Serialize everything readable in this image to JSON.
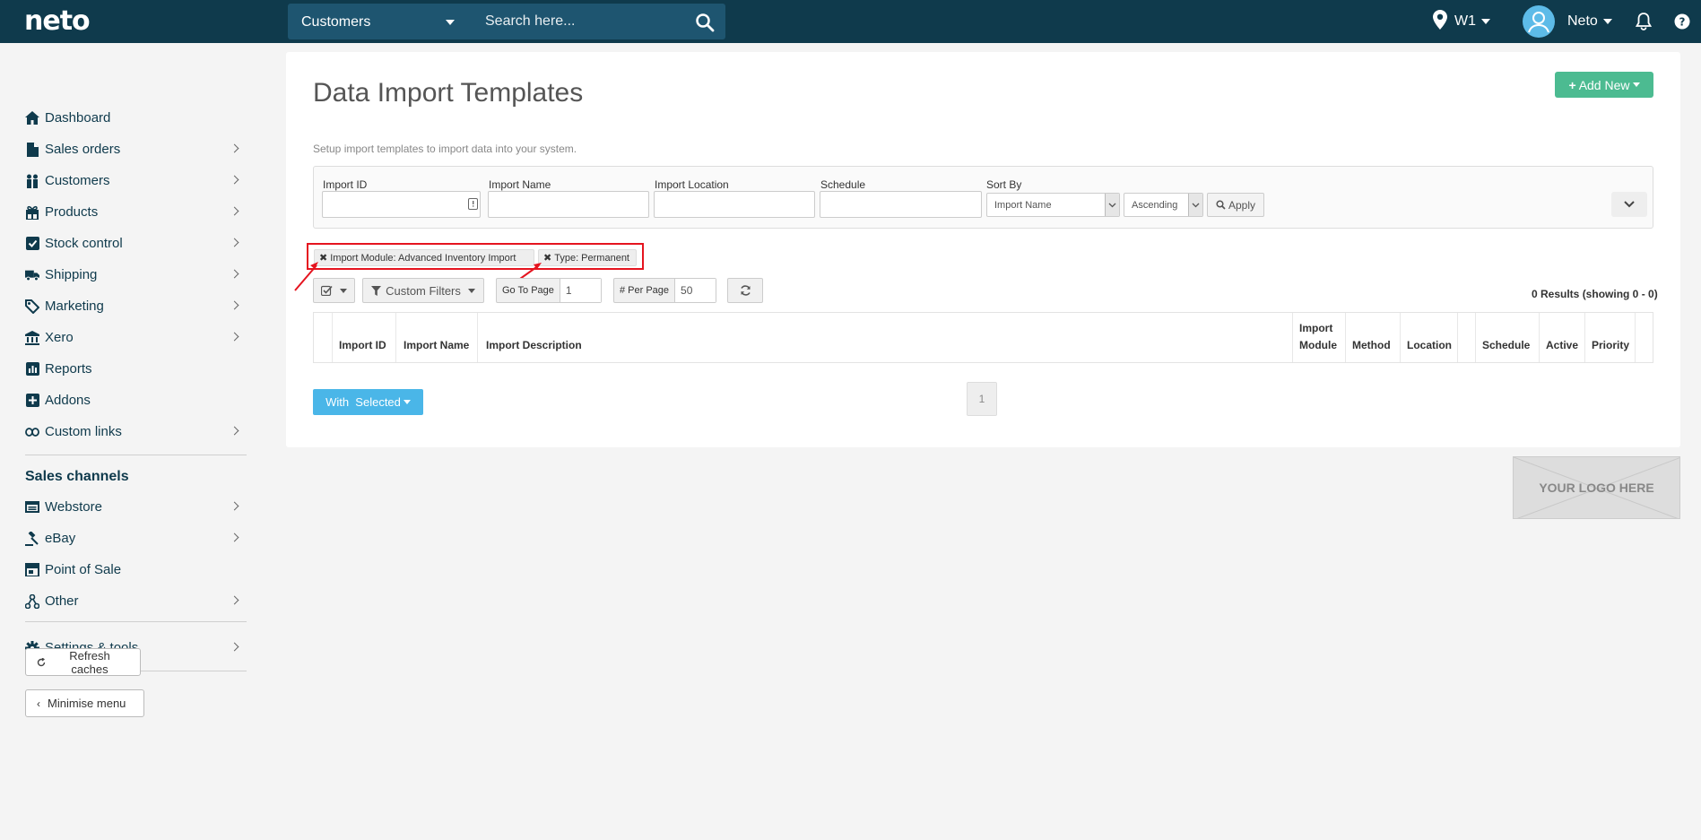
{
  "header": {
    "logo": "neto",
    "search_scope": "Customers",
    "search_placeholder": "Search here...",
    "location": "W1",
    "user": "Neto",
    "help": "?"
  },
  "sidebar": {
    "items": [
      {
        "label": "Dashboard",
        "icon": "home-icon"
      },
      {
        "label": "Sales orders",
        "icon": "document-icon"
      },
      {
        "label": "Customers",
        "icon": "users-icon"
      },
      {
        "label": "Products",
        "icon": "gift-icon"
      },
      {
        "label": "Stock control",
        "icon": "checkbox-icon"
      },
      {
        "label": "Shipping",
        "icon": "truck-icon"
      },
      {
        "label": "Marketing",
        "icon": "tags-icon"
      },
      {
        "label": "Xero",
        "icon": "bank-icon"
      },
      {
        "label": "Reports",
        "icon": "chart-icon"
      },
      {
        "label": "Addons",
        "icon": "plus-square-icon"
      },
      {
        "label": "Custom links",
        "icon": "link-icon"
      }
    ],
    "sales_channels_heading": "Sales channels",
    "channels": [
      {
        "label": "Webstore",
        "icon": "window-icon"
      },
      {
        "label": "eBay",
        "icon": "gavel-icon"
      },
      {
        "label": "Point of Sale",
        "icon": "store-icon"
      },
      {
        "label": "Other",
        "icon": "network-icon"
      }
    ],
    "settings": "Settings & tools",
    "refresh_caches": "Refresh caches",
    "minimise_menu": "Minimise menu"
  },
  "page": {
    "title": "Data Import Templates",
    "add_new": "Add New",
    "subtitle": "Setup import templates to import data into your system."
  },
  "filters": {
    "import_id_label": "Import ID",
    "import_name_label": "Import Name",
    "import_location_label": "Import Location",
    "schedule_label": "Schedule",
    "sort_by_label": "Sort By",
    "sort_by_value": "Import Name",
    "sort_order_value": "Ascending",
    "apply": "Apply"
  },
  "active_filters": [
    "Import Module: Advanced Inventory Import",
    "Type: Permanent"
  ],
  "toolbar": {
    "custom_filters": "Custom Filters",
    "go_to_page_label": "Go To Page",
    "go_to_page_value": "1",
    "per_page_label": "# Per Page",
    "per_page_value": "50",
    "results": "0 Results (showing 0 - 0)"
  },
  "table": {
    "columns": [
      "Import ID",
      "Import Name",
      "Import Description",
      "Import Module",
      "Method",
      "Location",
      "Schedule",
      "Active",
      "Priority"
    ]
  },
  "bottom": {
    "with_selected": "With  Selected",
    "page": "1",
    "logo_placeholder": "YOUR LOGO HERE"
  },
  "colors": {
    "topbar": "#0f3a4c",
    "add_new": "#4cbb91",
    "with_selected": "#4ab6e8",
    "highlight": "#e5141f"
  }
}
